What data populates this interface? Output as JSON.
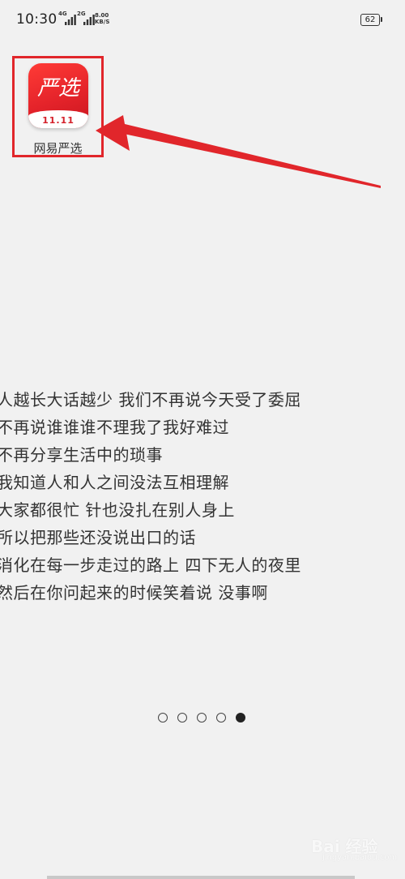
{
  "status_bar": {
    "time": "10:30",
    "signal_1_label": "4G",
    "signal_2_label": "2G",
    "net_speed_value": "8.00",
    "net_speed_unit": "KB/S",
    "battery": "62"
  },
  "app": {
    "icon_glyph": "严选",
    "icon_promo": "11.11",
    "label": "网易严选",
    "brand_color": "#e4232a",
    "highlight_color": "#e1262b"
  },
  "lyrics": [
    "人越长大话越少 我们不再说今天受了委屈",
    "不再说谁谁谁不理我了我好难过",
    "不再分享生活中的琐事",
    "我知道人和人之间没法互相理解",
    "大家都很忙 针也没扎在别人身上",
    "所以把那些还没说出口的话",
    "消化在每一步走过的路上 四下无人的夜里",
    "然后在你问起来的时候笑着说 没事啊"
  ],
  "pager": {
    "total": 5,
    "active_index": 4
  },
  "watermark": {
    "text": "Bai 经验",
    "sub": "jingyan.baidu.com"
  }
}
